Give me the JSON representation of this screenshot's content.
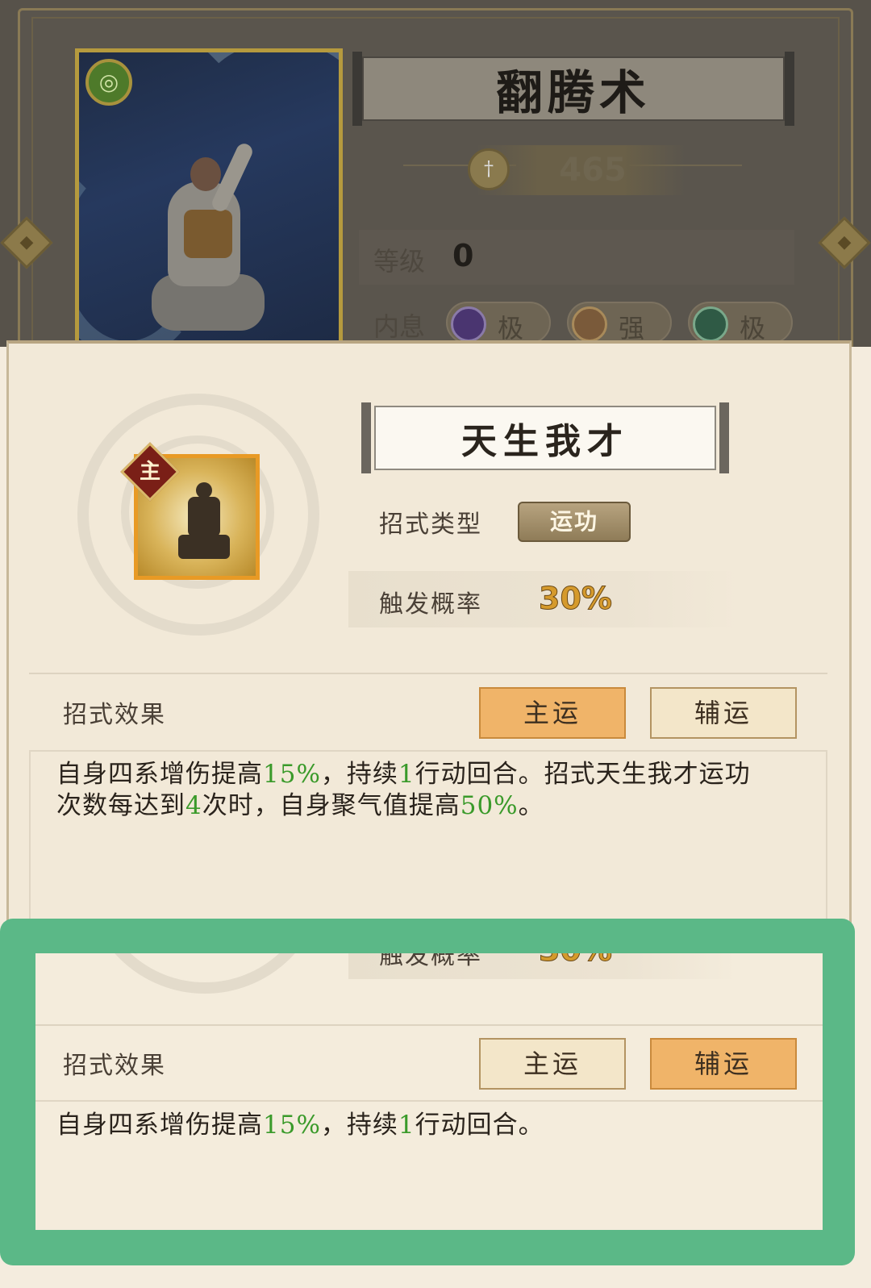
{
  "martial_art": {
    "name": "翻腾术",
    "power": "465",
    "level_label": "等级",
    "level": "0",
    "inner_label": "内息",
    "inner_slots": [
      {
        "label": "极",
        "color": "#5b3f8a"
      },
      {
        "label": "强",
        "color": "#9a6a4a"
      },
      {
        "label": "极",
        "color": "#3f7a5a"
      }
    ]
  },
  "skill": {
    "tag": "主",
    "name": "天生我才",
    "type_label": "招式类型",
    "type_value": "运功",
    "prob_label": "触发概率",
    "prob_value": "30%"
  },
  "effect": {
    "label": "招式效果",
    "btn_main": "主运",
    "btn_aux": "辅运",
    "main_desc": {
      "p1": "自身四系增伤提高",
      "v1": "15%",
      "p2": "，持续",
      "v2": "1",
      "p3": "行动回合。招式天生我才运功",
      "p4": "次数每达到",
      "v3": "4",
      "p5": "次时，自身聚气值提高",
      "v4": "50%",
      "p6": "。"
    },
    "aux_desc": {
      "p1": "自身四系增伤提高",
      "v1": "15%",
      "p2": "，持续",
      "v2": "1",
      "p3": "行动回合。"
    }
  },
  "colors": {
    "highlight": "#5bb887",
    "active_button": "#f0b469",
    "number_green": "#3a9a2a"
  }
}
